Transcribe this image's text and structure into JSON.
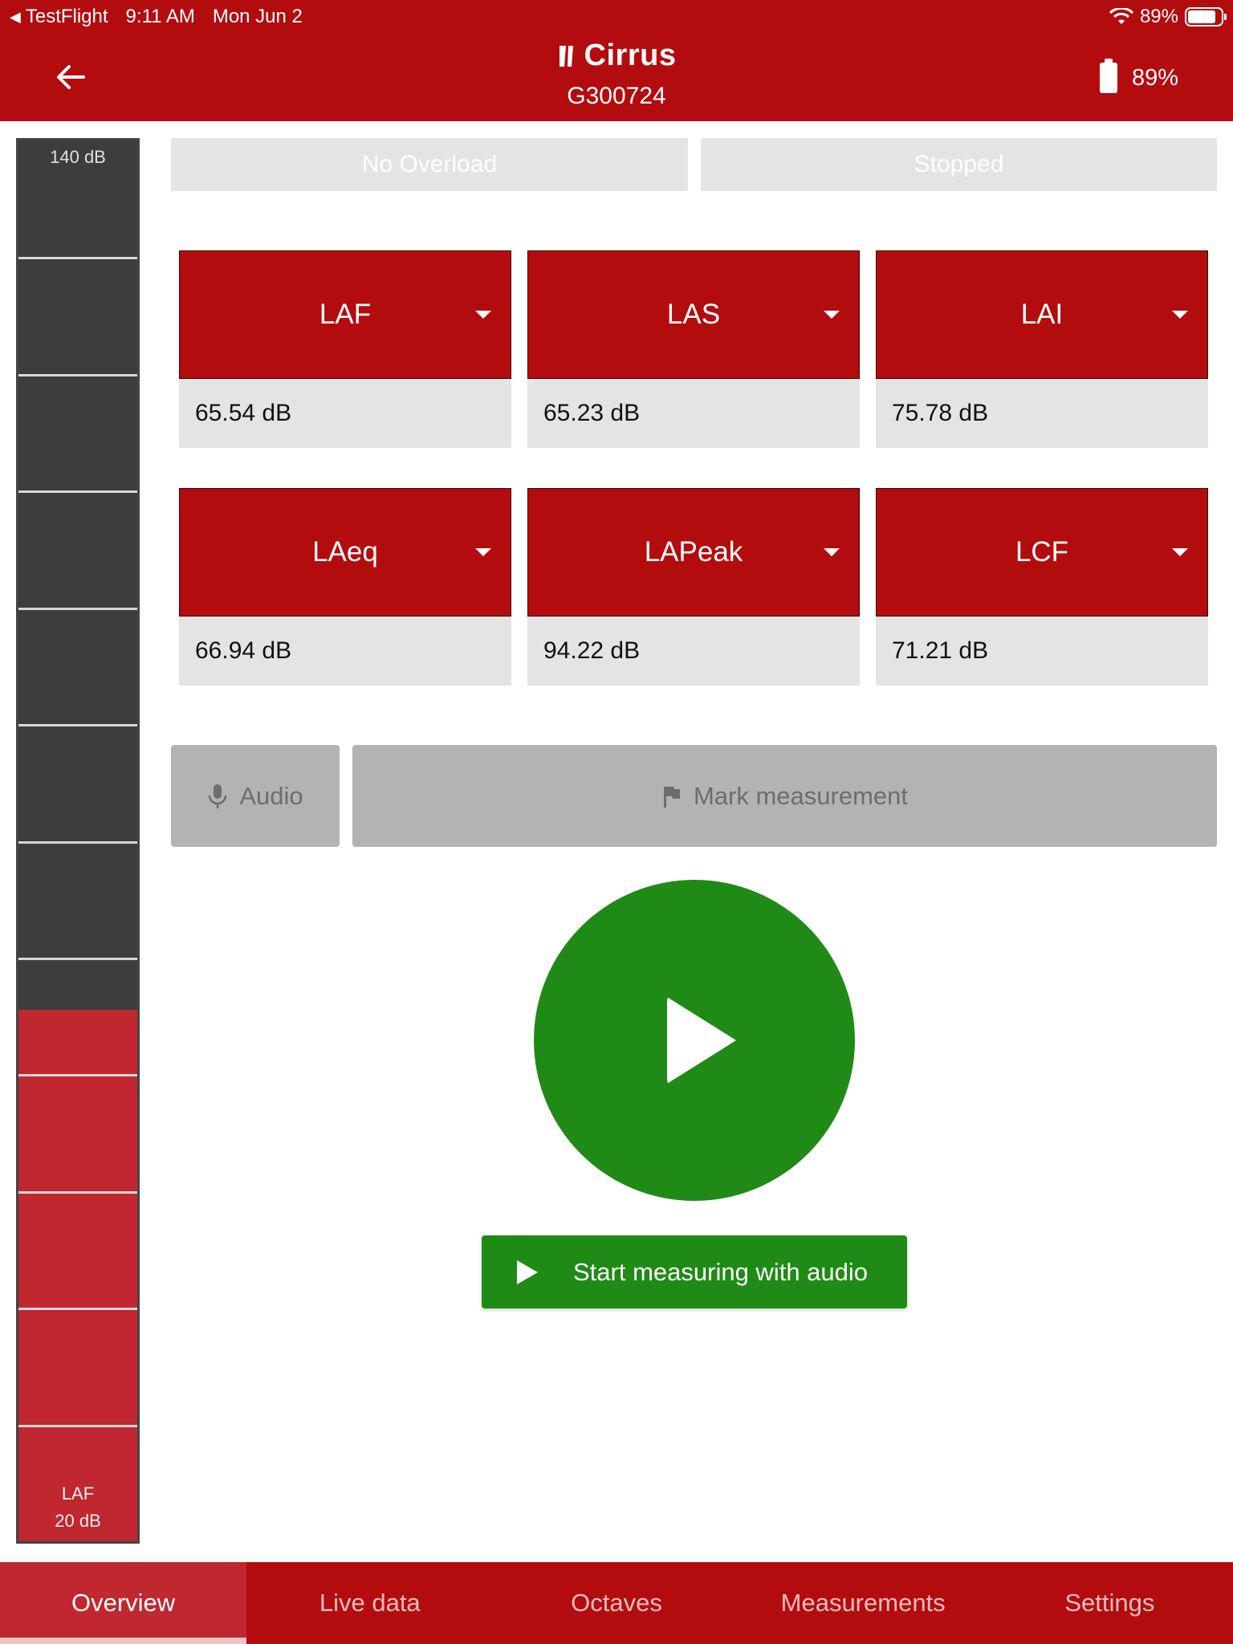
{
  "status_bar": {
    "app": "TestFlight",
    "time": "9:11 AM",
    "date": "Mon Jun 2",
    "battery": "89%"
  },
  "header": {
    "brand": "Cirrus",
    "device_id": "G300724",
    "device_battery": "89%"
  },
  "meter": {
    "top_label": "140 dB",
    "metric": "LAF",
    "bottom_label": "20 dB",
    "range_db": [
      20,
      140
    ],
    "level_db": 65.54
  },
  "status": {
    "overload": "No Overload",
    "state": "Stopped"
  },
  "metrics": [
    {
      "name": "LAF",
      "value": "65.54 dB"
    },
    {
      "name": "LAS",
      "value": "65.23 dB"
    },
    {
      "name": "LAI",
      "value": "75.78 dB"
    },
    {
      "name": "LAeq",
      "value": "66.94 dB"
    },
    {
      "name": "LAPeak",
      "value": "94.22 dB"
    },
    {
      "name": "LCF",
      "value": "71.21 dB"
    }
  ],
  "actions": {
    "audio": "Audio",
    "mark": "Mark measurement",
    "start": "Start measuring with audio"
  },
  "tabs": [
    "Overview",
    "Live data",
    "Octaves",
    "Measurements",
    "Settings"
  ],
  "colors": {
    "brand": "#b30c0f",
    "meter_fill": "#c0272e",
    "go": "#208a16"
  }
}
